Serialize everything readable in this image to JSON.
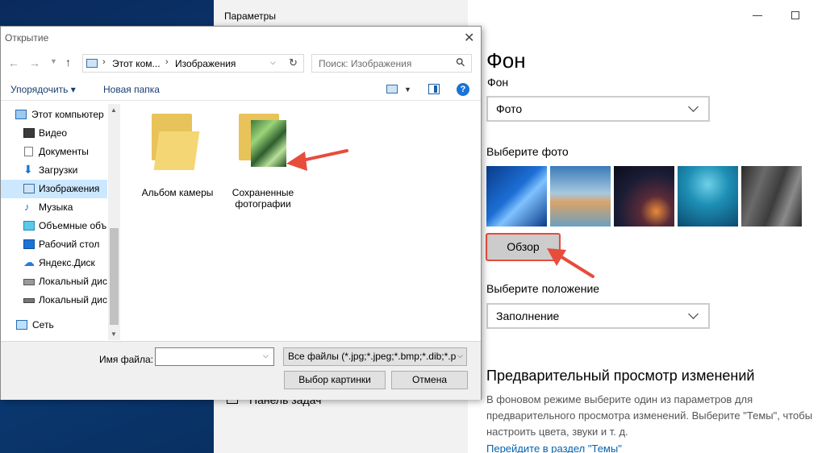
{
  "settings": {
    "window_title": "Параметры",
    "taskbar_item": "Панель задач",
    "background_heading": "Фон",
    "background_label": "Фон",
    "background_value": "Фото",
    "choose_photo_label": "Выберите фото",
    "browse_button": "Обзор",
    "position_label": "Выберите положение",
    "position_value": "Заполнение",
    "preview_heading": "Предварительный просмотр изменений",
    "preview_text": "В фоновом режиме выберите один из параметров для предварительного просмотра изменений. Выберите \"Темы\", чтобы настроить цвета, звуки и т. д.",
    "themes_link": "Перейдите в раздел \"Темы\""
  },
  "dialog": {
    "title": "Открытие",
    "breadcrumb": [
      "Этот ком...",
      "Изображения"
    ],
    "search_placeholder": "Поиск: Изображения",
    "toolbar": {
      "organize": "Упорядочить ▾",
      "new_folder": "Новая папка"
    },
    "nav_items": [
      {
        "label": "Этот компьютер",
        "icon": "computer-icon",
        "selected": false
      },
      {
        "label": "Видео",
        "icon": "video-icon",
        "selected": false
      },
      {
        "label": "Документы",
        "icon": "documents-icon",
        "selected": false
      },
      {
        "label": "Загрузки",
        "icon": "downloads-icon",
        "selected": false
      },
      {
        "label": "Изображения",
        "icon": "pictures-icon",
        "selected": true
      },
      {
        "label": "Музыка",
        "icon": "music-icon",
        "selected": false
      },
      {
        "label": "Объемные объ",
        "icon": "3d-objects-icon",
        "selected": false
      },
      {
        "label": "Рабочий стол",
        "icon": "desktop-icon",
        "selected": false
      },
      {
        "label": "Яндекс.Диск",
        "icon": "yandex-disk-icon",
        "selected": false
      },
      {
        "label": "Локальный дис",
        "icon": "drive-icon",
        "selected": false
      },
      {
        "label": "Локальный дис",
        "icon": "drive-icon",
        "selected": false
      },
      {
        "label": "Сеть",
        "icon": "network-icon",
        "selected": false
      }
    ],
    "folders": [
      {
        "label": "Альбом камеры"
      },
      {
        "label": "Сохраненные фотографии"
      }
    ],
    "filename_label": "Имя файла:",
    "filename_value": "",
    "filetype_value": "Все файлы (*.jpg;*.jpeg;*.bmp;*.dib;*.p",
    "open_button": "Выбор картинки",
    "cancel_button": "Отмена"
  },
  "colors": {
    "accent_red": "#e74c3c",
    "link_blue": "#0063b1",
    "selection": "#cce8ff"
  }
}
